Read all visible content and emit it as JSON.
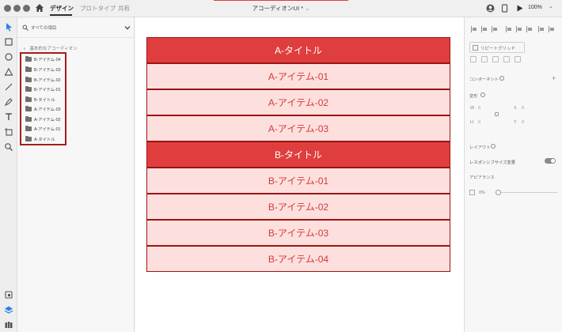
{
  "titlebar": {
    "tabs": [
      {
        "label": "デザイン",
        "active": true
      },
      {
        "label": "プロトタイプ",
        "active": false
      },
      {
        "label": "共有",
        "active": false
      }
    ],
    "document_title": "アコーディオンUI *",
    "zoom": "100%"
  },
  "tools": [
    "select-icon",
    "rectangle-icon",
    "ellipse-icon",
    "triangle-icon",
    "line-icon",
    "pen-icon",
    "text-icon",
    "artboard-icon",
    "zoom-icon",
    "plugins-icon",
    "layers-icon",
    "libraries-icon"
  ],
  "layers_panel": {
    "filter_label": "すべての項目",
    "breadcrumb": "基本的なアコーディオン",
    "items": [
      "B-アイテム-04",
      "B-アイテム-03",
      "B-アイテム-02",
      "B-アイテム-01",
      "B-タイトル",
      "A-アイテム-03",
      "A-アイテム-02",
      "A-アイテム-01",
      "A-タイトル"
    ]
  },
  "canvas": {
    "rows": [
      {
        "label": "A-タイトル",
        "kind": "title"
      },
      {
        "label": "A-アイテム-01",
        "kind": "item"
      },
      {
        "label": "A-アイテム-02",
        "kind": "item"
      },
      {
        "label": "A-アイテム-03",
        "kind": "item"
      },
      {
        "label": "B-タイトル",
        "kind": "title"
      },
      {
        "label": "B-アイテム-01",
        "kind": "item"
      },
      {
        "label": "B-アイテム-02",
        "kind": "item"
      },
      {
        "label": "B-アイテム-03",
        "kind": "item"
      },
      {
        "label": "B-アイテム-04",
        "kind": "item"
      }
    ],
    "colors": {
      "title_bg": "#e03e3e",
      "item_bg": "#fde0de",
      "border": "#9a1414",
      "item_text": "#d23b3b"
    }
  },
  "properties": {
    "repeat_grid_label": "リピートグリッド",
    "component_label": "コンポーネント",
    "transform_label": "変形",
    "w_label": "W",
    "w_value": "0",
    "x_label": "X",
    "x_value": "0",
    "h_label": "H",
    "h_value": "0",
    "y_label": "Y",
    "y_value": "0",
    "layout_label": "レイアウト",
    "responsive_label": "レスポンシブサイズ変更",
    "appearance_label": "アピアランス",
    "opacity_value": "0%"
  }
}
